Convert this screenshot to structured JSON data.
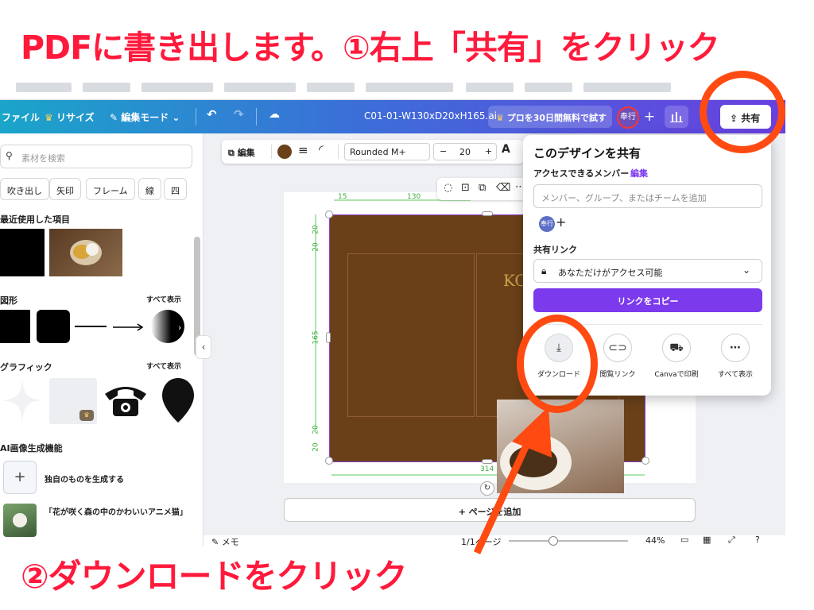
{
  "instructions": {
    "top": "PDFに書き出します。①右上「共有」をクリック",
    "bottom": "②ダウンロードをクリック"
  },
  "toolbar": {
    "file": "ファイル",
    "resize": "リサイズ",
    "edit_mode": "編集モード",
    "filename": "C01-01-W130xD20xH165.ai",
    "pro_trial": "プロを30日間無料で試す",
    "avatar": "奉行",
    "share": "共有"
  },
  "left_panel": {
    "search_placeholder": "素材を検索",
    "chips": [
      "吹き出し",
      "矢印",
      "フレーム",
      "線",
      "四"
    ],
    "recent": "最近使用した項目",
    "shapes": "図形",
    "graphics": "グラフィック",
    "see_all": "すべて表示",
    "ai": "AI画像生成機能",
    "ai_create": "独自のものを生成する",
    "ai_prompt": "「花が咲く森の中のかわいいアニメ猫」"
  },
  "context_bar": {
    "edit": "編集",
    "font": "Rounded M+",
    "size": "20"
  },
  "canvas": {
    "dim_15": "15",
    "dim_130": "130",
    "dim_20a": "20",
    "dim_20b": "20",
    "dim_165": "165",
    "dim_20c": "20",
    "dim_20d": "20",
    "dim_314": "314",
    "box_text": "KO",
    "add_page": "+ ページを追加"
  },
  "bottom_bar": {
    "notes": "メモ",
    "page": "1/1ページ",
    "zoom": "44%"
  },
  "share_popup": {
    "title": "このデザインを共有",
    "members_label": "アクセスできるメンバー",
    "edit_link": "編集",
    "input_placeholder": "メンバー、グループ、またはチームを追加",
    "member_avatar": "奉行",
    "link_label": "共有リンク",
    "access": "あなただけがアクセス可能",
    "copy_button": "リンクをコピー",
    "options": [
      {
        "label": "ダウンロード",
        "icon": "download-icon"
      },
      {
        "label": "閲覧リンク",
        "icon": "link-icon"
      },
      {
        "label": "Canvaで印刷",
        "icon": "truck-icon"
      },
      {
        "label": "すべて表示",
        "icon": "more-icon"
      }
    ]
  },
  "colors": {
    "annotation_text": "#ff1a3c",
    "annotation_ring": "#ff4a12",
    "accent": "#7c3aed",
    "box_fill": "#6a4019"
  }
}
